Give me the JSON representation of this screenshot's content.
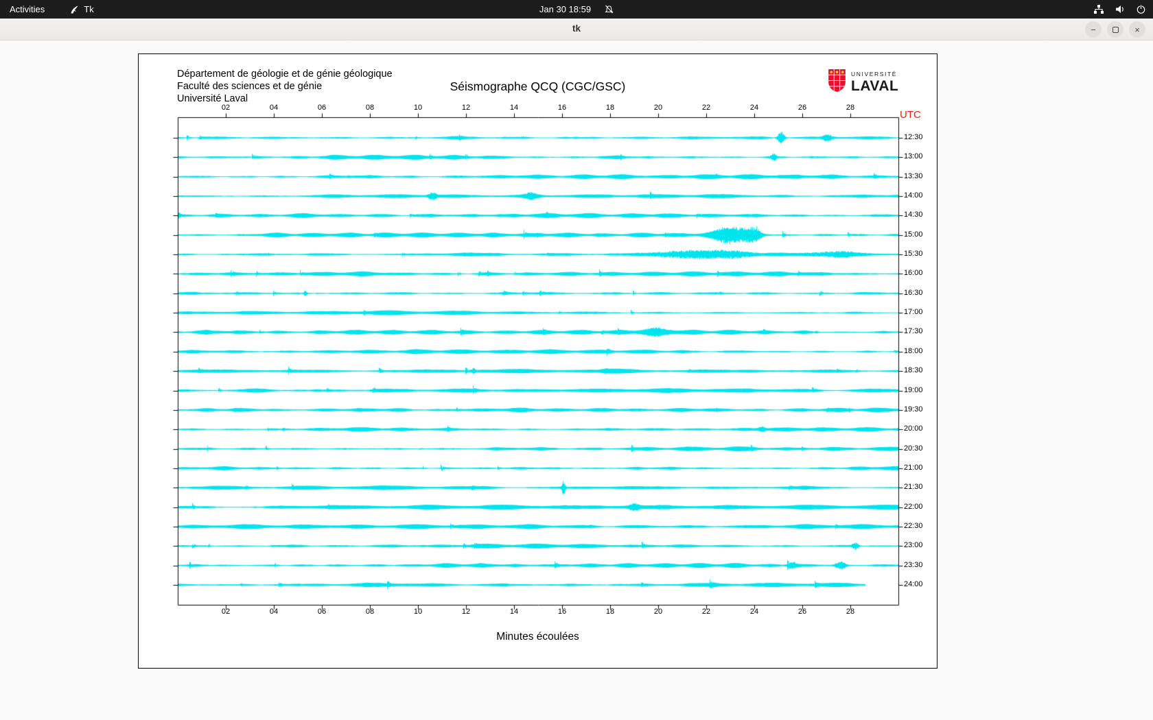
{
  "top_bar": {
    "activities_label": "Activities",
    "app_indicator_label": "Tk",
    "clock": "Jan 30 18:59",
    "icons": {
      "app": "tk-feather",
      "notifications": "bell-crossed",
      "network": "network-nodes",
      "volume": "speaker",
      "power": "power"
    }
  },
  "window": {
    "title": "tk",
    "controls": {
      "minimize_glyph": "−",
      "close_glyph": "×"
    }
  },
  "header": {
    "dept_line1": "Département de géologie et de génie géologique",
    "dept_line2": "Faculté des sciences et de génie",
    "dept_line3": "Université Laval",
    "logo_small": "UNIVERSITÉ",
    "logo_large": "LAVAL"
  },
  "chart_data": {
    "type": "line",
    "title": "Séismographe QCQ (CGC/GSC)",
    "xlabel": "Minutes écoulées",
    "utc_label": "UTC",
    "utc_color": "#ee1c0e",
    "trace_color": "#00e4ee",
    "axis_color": "#000000",
    "background": "#ffffff",
    "x_range_minutes": [
      0,
      30
    ],
    "x_ticks": [
      "02",
      "04",
      "06",
      "08",
      "10",
      "12",
      "14",
      "16",
      "18",
      "20",
      "22",
      "24",
      "26",
      "28"
    ],
    "row_interval_minutes": 30,
    "rows": 24,
    "row_labels": [
      "12:30",
      "13:00",
      "13:30",
      "14:00",
      "14:30",
      "15:00",
      "15:30",
      "16:00",
      "16:30",
      "17:00",
      "17:30",
      "18:00",
      "18:30",
      "19:00",
      "19:30",
      "20:00",
      "20:30",
      "21:00",
      "21:30",
      "22:00",
      "22:30",
      "23:00",
      "23:30",
      "24:00"
    ],
    "last_row_end_minute": 28.6,
    "events": [
      {
        "row": 0,
        "minute": 25.1,
        "amplitude": 9,
        "width_minutes": 0.1
      },
      {
        "row": 0,
        "minute": 27.0,
        "amplitude": 4,
        "width_minutes": 0.12
      },
      {
        "row": 1,
        "minute": 24.8,
        "amplitude": 5,
        "width_minutes": 0.08
      },
      {
        "row": 3,
        "minute": 10.6,
        "amplitude": 5,
        "width_minutes": 0.12
      },
      {
        "row": 3,
        "minute": 14.7,
        "amplitude": 4,
        "width_minutes": 0.2
      },
      {
        "row": 5,
        "minute": 23.0,
        "amplitude": 12,
        "width_minutes": 0.45
      },
      {
        "row": 5,
        "minute": 23.9,
        "amplitude": 8,
        "width_minutes": 0.25
      },
      {
        "row": 6,
        "minute": 21.2,
        "amplitude": 5,
        "width_minutes": 1.2
      },
      {
        "row": 6,
        "minute": 23.1,
        "amplitude": 4,
        "width_minutes": 0.7
      },
      {
        "row": 6,
        "minute": 27.3,
        "amplitude": 4,
        "width_minutes": 0.8
      },
      {
        "row": 8,
        "minute": 5.3,
        "amplitude": 4,
        "width_minutes": 0.05
      },
      {
        "row": 10,
        "minute": 20.0,
        "amplitude": 4,
        "width_minutes": 0.5
      },
      {
        "row": 12,
        "minute": 12.3,
        "amplitude": 4,
        "width_minutes": 0.05
      },
      {
        "row": 15,
        "minute": 24.3,
        "amplitude": 4,
        "width_minutes": 0.1
      },
      {
        "row": 18,
        "minute": 16.05,
        "amplitude": 11,
        "width_minutes": 0.05
      },
      {
        "row": 19,
        "minute": 19.0,
        "amplitude": 4,
        "width_minutes": 0.15
      },
      {
        "row": 21,
        "minute": 28.2,
        "amplitude": 5,
        "width_minutes": 0.1
      },
      {
        "row": 22,
        "minute": 25.6,
        "amplitude": 5,
        "width_minutes": 0.15
      },
      {
        "row": 22,
        "minute": 27.6,
        "amplitude": 5,
        "width_minutes": 0.15
      }
    ]
  }
}
